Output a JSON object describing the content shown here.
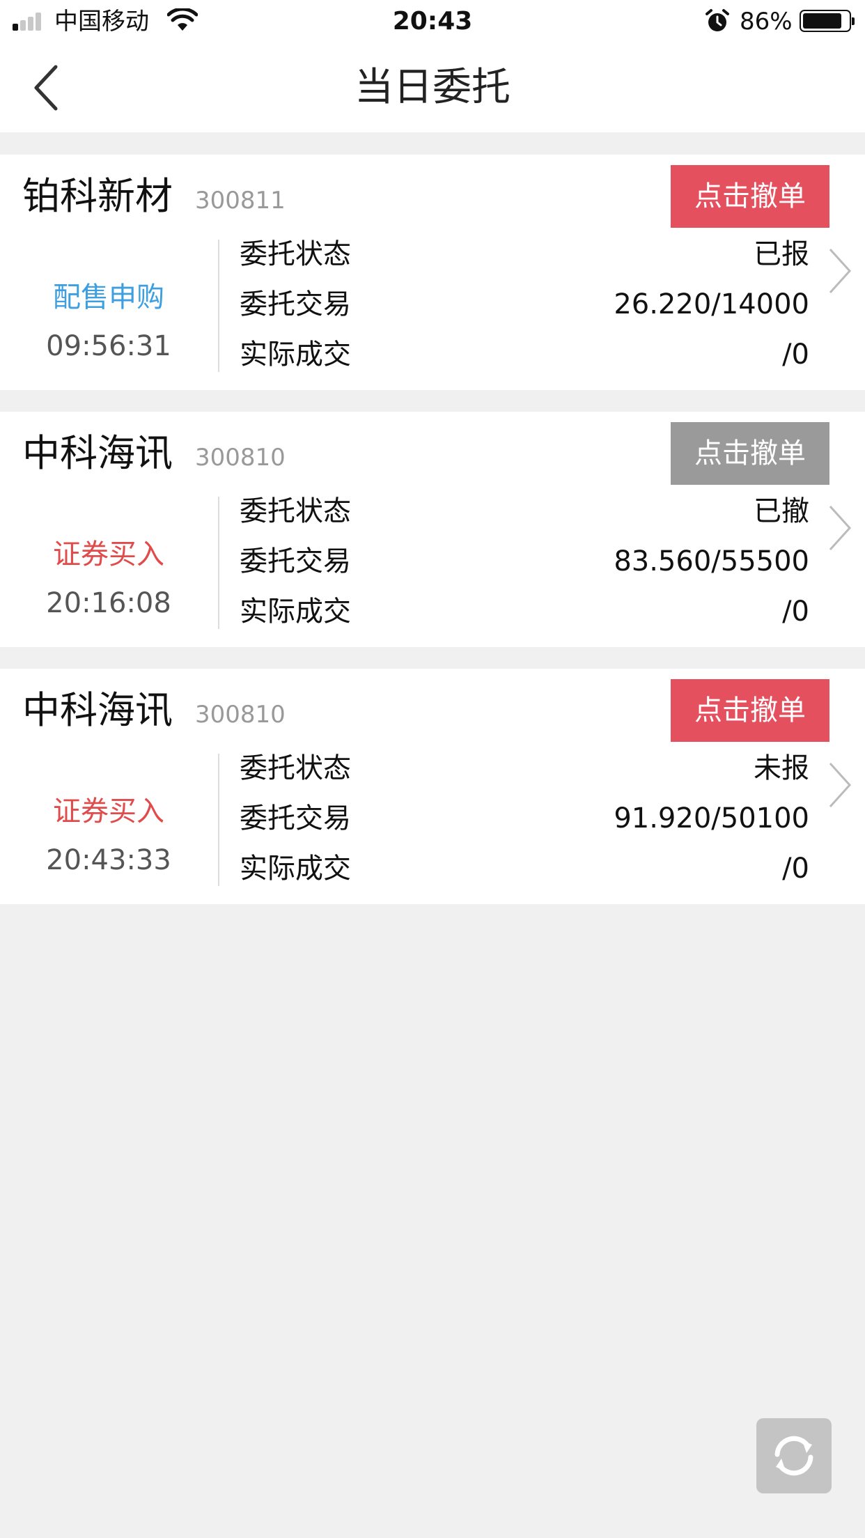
{
  "status_bar": {
    "carrier": "中国移动",
    "time": "20:43",
    "battery": "86%",
    "battery_level": 0.86,
    "icons": [
      "signal-icon",
      "wifi-icon",
      "alarm-icon",
      "battery-icon"
    ]
  },
  "nav": {
    "title": "当日委托",
    "back_icon": "chevron-left-icon"
  },
  "colors": {
    "cancel_active": "#e5505e",
    "cancel_disabled": "#9a9a9a",
    "subscribe_blue": "#3d9fe0",
    "buy_red": "#e04b4b"
  },
  "orders": [
    {
      "name": "铂科新材",
      "code": "300811",
      "cancel_label": "点击撤单",
      "cancel_enabled": true,
      "type": "配售申购",
      "type_color": "#3d9fe0",
      "time": "09:56:31",
      "fields": [
        {
          "label": "委托状态",
          "value": "已报"
        },
        {
          "label": "委托交易",
          "value": "26.220/14000"
        },
        {
          "label": "实际成交",
          "value": "/0"
        }
      ]
    },
    {
      "name": "中科海讯",
      "code": "300810",
      "cancel_label": "点击撤单",
      "cancel_enabled": false,
      "type": "证券买入",
      "type_color": "#e04b4b",
      "time": "20:16:08",
      "fields": [
        {
          "label": "委托状态",
          "value": "已撤"
        },
        {
          "label": "委托交易",
          "value": "83.560/55500"
        },
        {
          "label": "实际成交",
          "value": "/0"
        }
      ]
    },
    {
      "name": "中科海讯",
      "code": "300810",
      "cancel_label": "点击撤单",
      "cancel_enabled": true,
      "type": "证券买入",
      "type_color": "#e04b4b",
      "time": "20:43:33",
      "fields": [
        {
          "label": "委托状态",
          "value": "未报"
        },
        {
          "label": "委托交易",
          "value": "91.920/50100"
        },
        {
          "label": "实际成交",
          "value": "/0"
        }
      ]
    }
  ],
  "refresh_icon": "refresh-icon"
}
